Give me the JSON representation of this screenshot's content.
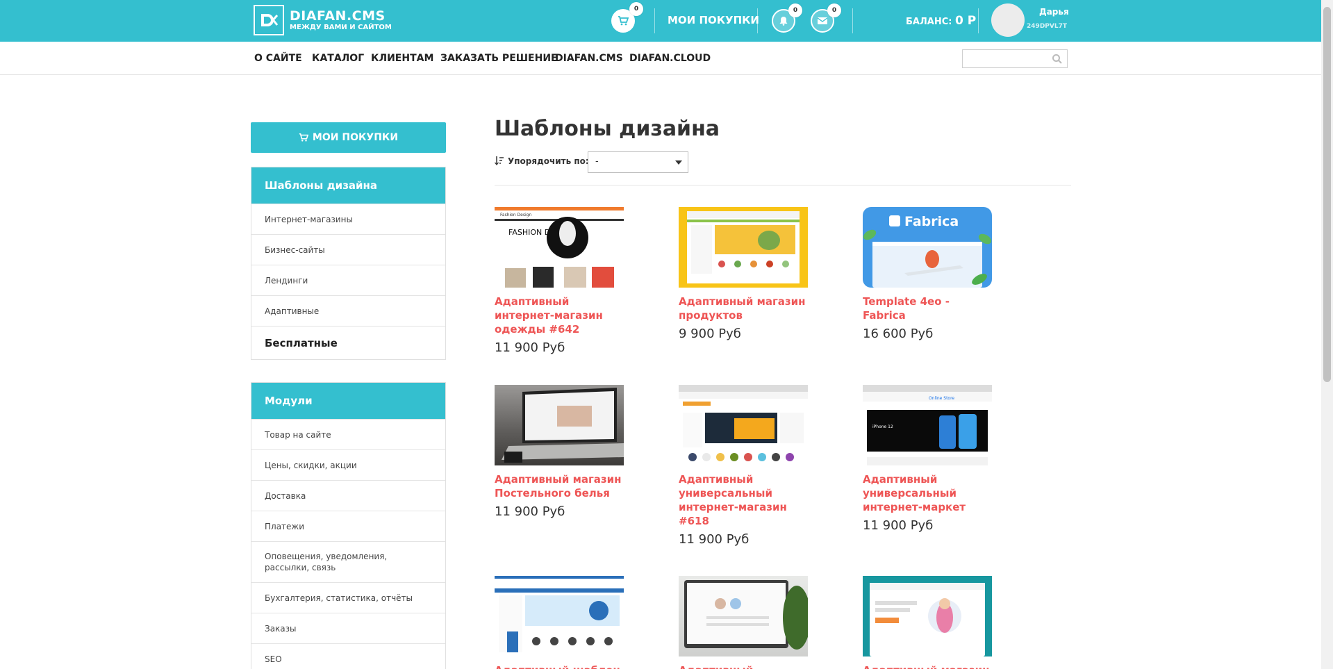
{
  "header": {
    "logo_title": "DIAFAN.CMS",
    "logo_subtitle": "МЕЖДУ ВАМИ И САЙТОМ",
    "cart_count": "0",
    "my_purchases": "МОИ ПОКУПКИ",
    "notifications_count": "0",
    "messages_count": "0",
    "balance_label": "БАЛАНС:",
    "balance_value": "0 Р",
    "user_name": "Дарья",
    "user_id": "249DPVL7T"
  },
  "nav": {
    "items": [
      "О САЙТЕ",
      "КАТАЛОГ",
      "КЛИЕНТАМ",
      "ЗАКАЗАТЬ РЕШЕНИЕ",
      "DIAFAN.CMS",
      "DIAFAN.CLOUD"
    ],
    "search_value": ""
  },
  "sidebar": {
    "purchases_button": "МОИ ПОКУПКИ",
    "templates": {
      "title": "Шаблоны дизайна",
      "items": [
        "Интернет-магазины",
        "Бизнес-сайты",
        "Лендинги",
        "Адаптивные",
        "Бесплатные"
      ]
    },
    "modules": {
      "title": "Модули",
      "items": [
        "Товар на сайте",
        "Цены, скидки, акции",
        "Доставка",
        "Платежи",
        "Оповещения, уведомления, рассылки, связь",
        "Бухгалтерия, статистика, отчёты",
        "Заказы",
        "SEO"
      ]
    }
  },
  "main": {
    "title": "Шаблоны дизайна",
    "sort_label": "Упорядочить по:",
    "sort_value": "-",
    "products": [
      {
        "title": "Адаптивный интернет-магазин одежды #642",
        "price": "11 900 Руб"
      },
      {
        "title": "Адаптивный магазин продуктов",
        "price": "9 900 Руб"
      },
      {
        "title": "Template 4eo - Fabrica",
        "price": "16 600 Руб"
      },
      {
        "title": "Адаптивный магазин Постельного белья",
        "price": "11 900 Руб"
      },
      {
        "title": "Адаптивный универсальный интернет-магазин #618",
        "price": "11 900 Руб"
      },
      {
        "title": "Адаптивный универсальный интернет-маркет",
        "price": "11 900 Руб"
      },
      {
        "title": "Адаптивный шаблон",
        "price": ""
      },
      {
        "title": "Адаптивный",
        "price": ""
      },
      {
        "title": "Адаптивный магазин",
        "price": ""
      }
    ],
    "thumb_text": {
      "fashion_header": "Fashion Design",
      "fashion_big": "FASHION DESIGN",
      "fabrica_brand": "Fabrica",
      "market_store": "Online Store",
      "market_phone": "iPhone 12"
    }
  },
  "colors": {
    "accent": "#34bfcf",
    "link_red": "#e55555",
    "text": "#333333"
  }
}
